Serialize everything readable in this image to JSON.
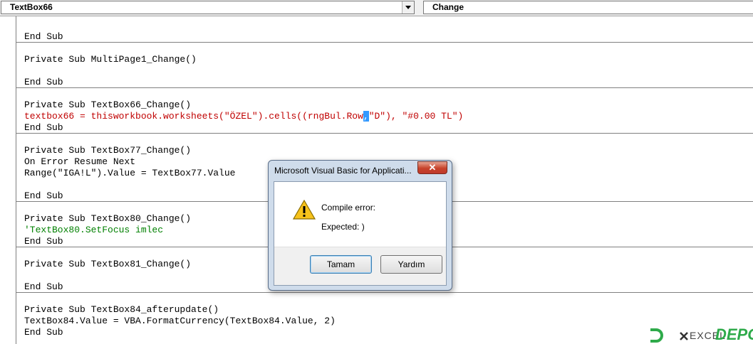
{
  "toolbar": {
    "object_combo": "TextBox66",
    "procedure_combo": "Change"
  },
  "code": {
    "lines": [
      "End Sub",
      "Private Sub MultiPage1_Change()",
      "End Sub",
      "Private Sub TextBox66_Change()",
      "textbox66 = thisworkbook.worksheets(\"ÖZEL\").cells((rngBul.Row",
      ",",
      "\"D\"), \"#0.00 TL\")",
      "End Sub",
      "Private Sub TextBox77_Change()",
      "On Error Resume Next",
      "Range(\"IGA!L\").Value = TextBox77.Value",
      "End Sub",
      "Private Sub TextBox80_Change()",
      "'TextBox80.SetFocus imlec",
      "End Sub",
      "Private Sub TextBox81_Change()",
      "End Sub",
      "Private Sub TextBox84_afterupdate()",
      "TextBox84.Value = VBA.FormatCurrency(TextBox84.Value, 2)",
      "End Sub"
    ]
  },
  "dialog": {
    "title": "Microsoft Visual Basic for Applicati...",
    "close_glyph": "✕",
    "message_title": "Compile error:",
    "message_detail": "Expected: )",
    "ok_label": "Tamam",
    "help_label": "Yardım",
    "icon": "warning-icon"
  },
  "watermark": {
    "text": "EXCEL",
    "brand": "DEPO"
  },
  "colors": {
    "error_text": "#c00000",
    "comment_text": "#008000",
    "selection": "#3399ff"
  }
}
